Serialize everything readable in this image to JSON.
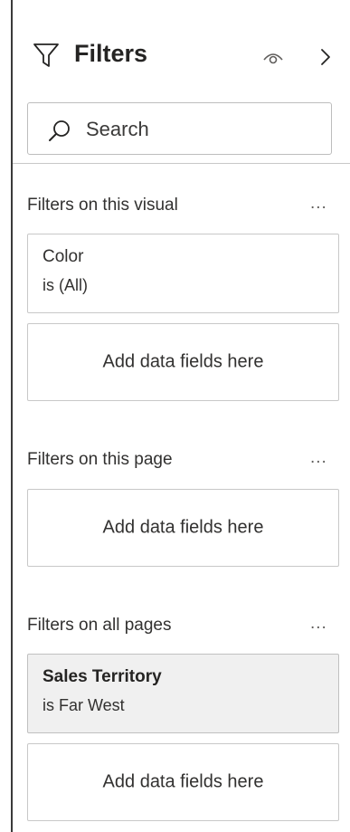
{
  "header": {
    "title": "Filters",
    "icons": {
      "filter": "filter-funnel-icon",
      "visibility": "eye-icon",
      "collapse": "chevron-right-icon"
    }
  },
  "search": {
    "placeholder": "Search",
    "value": ""
  },
  "sections": {
    "visual": {
      "label": "Filters on this visual",
      "more": "...",
      "filter_card": {
        "field": "Color",
        "condition": "is (All)"
      },
      "dropzone": "Add data fields here"
    },
    "page": {
      "label": "Filters on this page",
      "more": "...",
      "dropzone": "Add data fields here"
    },
    "all_pages": {
      "label": "Filters on all pages",
      "more": "...",
      "filter_card": {
        "field": "Sales Territory",
        "condition": "is Far West"
      },
      "dropzone": "Add data fields here"
    }
  },
  "colors": {
    "active_card_bg": "#f0f0f0",
    "border": "#c8c8c8",
    "text": "#252423"
  }
}
